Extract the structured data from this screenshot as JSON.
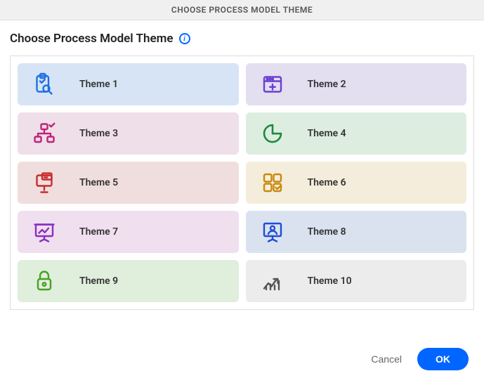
{
  "header": {
    "title": "CHOOSE PROCESS MODEL THEME"
  },
  "subtitle": "Choose Process Model Theme",
  "info_glyph": "i",
  "themes": [
    {
      "label": "Theme 1",
      "icon": "clipboard-search",
      "color": "#1d6fe6",
      "bgClass": "t1"
    },
    {
      "label": "Theme 2",
      "icon": "browser-add",
      "color": "#6b3fd1",
      "bgClass": "t2"
    },
    {
      "label": "Theme 3",
      "icon": "org-chart-check",
      "color": "#c02277",
      "bgClass": "t3"
    },
    {
      "label": "Theme 4",
      "icon": "pie-slice",
      "color": "#1f8a3d",
      "bgClass": "t4"
    },
    {
      "label": "Theme 5",
      "icon": "presentation-chat",
      "color": "#c82b2b",
      "bgClass": "t5"
    },
    {
      "label": "Theme 6",
      "icon": "grid-apps",
      "color": "#c88a0c",
      "bgClass": "t6"
    },
    {
      "label": "Theme 7",
      "icon": "chart-board",
      "color": "#8b2fbf",
      "bgClass": "t7"
    },
    {
      "label": "Theme 8",
      "icon": "user-board",
      "color": "#1d4fd6",
      "bgClass": "t8"
    },
    {
      "label": "Theme 9",
      "icon": "lock",
      "color": "#4aa024",
      "bgClass": "t9"
    },
    {
      "label": "Theme 10",
      "icon": "trend-up",
      "color": "#555555",
      "bgClass": "t10"
    }
  ],
  "footer": {
    "cancel": "Cancel",
    "ok": "OK"
  }
}
